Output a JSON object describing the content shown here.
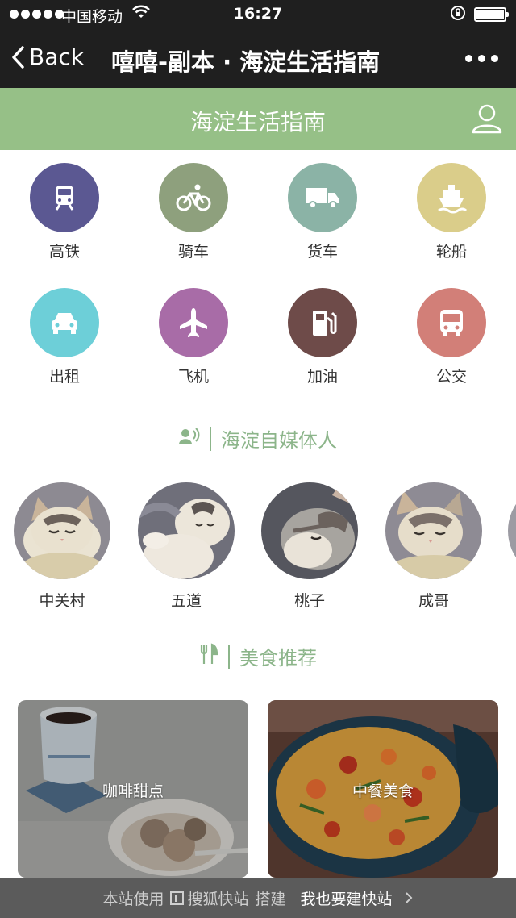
{
  "status_bar": {
    "carrier": "中国移动",
    "time": "16:27"
  },
  "nav": {
    "back_label": "Back",
    "title": "嘻嘻-副本 · 海淀生活指南"
  },
  "header": {
    "site_title": "海淀生活指南"
  },
  "grid_items": [
    {
      "label": "高铁",
      "icon": "train-icon",
      "color": "#5b5892"
    },
    {
      "label": "骑车",
      "icon": "bicycle-icon",
      "color": "#8ea07d"
    },
    {
      "label": "货车",
      "icon": "truck-icon",
      "color": "#8bb3a6"
    },
    {
      "label": "轮船",
      "icon": "ship-icon",
      "color": "#dacd8a"
    },
    {
      "label": "出租",
      "icon": "taxi-icon",
      "color": "#6dcfd8"
    },
    {
      "label": "飞机",
      "icon": "airplane-icon",
      "color": "#a86ca7"
    },
    {
      "label": "加油",
      "icon": "fuel-icon",
      "color": "#6e4b49"
    },
    {
      "label": "公交",
      "icon": "bus-icon",
      "color": "#d27f78"
    }
  ],
  "media_section": {
    "title": "海淀自媒体人"
  },
  "media_people": [
    {
      "name": "中关村"
    },
    {
      "name": "五道"
    },
    {
      "name": "桃子"
    },
    {
      "name": "成哥"
    }
  ],
  "food_section": {
    "title": "美食推荐"
  },
  "food_cards": [
    {
      "caption": "咖啡甜点"
    },
    {
      "caption": "中餐美食"
    }
  ],
  "footer": {
    "prefix": "本站使用",
    "brand": "搜狐快站",
    "suffix": "搭建",
    "build_link": "我也要建快站"
  }
}
